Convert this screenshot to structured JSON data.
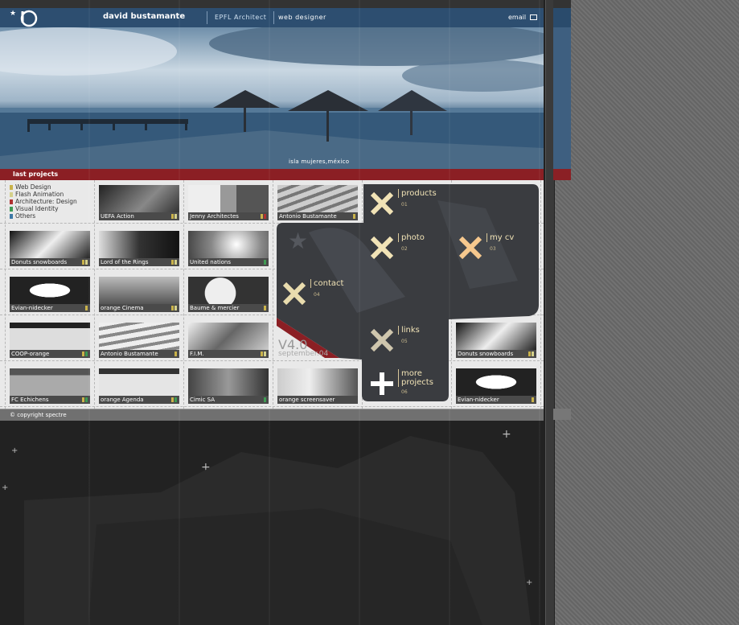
{
  "header": {
    "name": "david bustamante",
    "role1": "EPFL Architect",
    "role2": "web designer",
    "email": "email"
  },
  "hero": {
    "caption": "isla mujeres,méxico"
  },
  "last_projects": {
    "title": "last projects"
  },
  "categories": [
    {
      "label": "Web Design",
      "color": "#c9b24a"
    },
    {
      "label": "Flash Animation",
      "color": "#d4d08a"
    },
    {
      "label": "Architecture: Design",
      "color": "#b03030"
    },
    {
      "label": "Visual Identity",
      "color": "#3f9a54"
    },
    {
      "label": "Others",
      "color": "#3c78a6"
    }
  ],
  "projects": [
    {
      "label": "UEFA Action"
    },
    {
      "label": "Jenny Architectes"
    },
    {
      "label": "Antonio Bustamante"
    },
    {
      "label": "Donuts snowboards"
    },
    {
      "label": "Lord of the Rings"
    },
    {
      "label": "United nations"
    },
    {
      "label": "Evian-nidecker"
    },
    {
      "label": "orange Cinema"
    },
    {
      "label": "Baume & mercier"
    },
    {
      "label": "COOP-orange"
    },
    {
      "label": "Antonio Bustamante"
    },
    {
      "label": "F.I.M."
    },
    {
      "label": "FC Echichens"
    },
    {
      "label": "orange Agenda"
    },
    {
      "label": "Cimic SA"
    },
    {
      "label": "orange screensaver"
    },
    {
      "label": "Donuts snowboards"
    },
    {
      "label": "Evian-nidecker"
    }
  ],
  "nav": [
    {
      "label": "products",
      "num": "01"
    },
    {
      "label": "photo",
      "num": "02"
    },
    {
      "label": "my cv",
      "num": "03"
    },
    {
      "label": "contact",
      "num": "04"
    },
    {
      "label": "links",
      "num": "05"
    },
    {
      "label": "more projects",
      "num": "06"
    }
  ],
  "version": {
    "v": "V4.0",
    "date": "september.04"
  },
  "footer": {
    "copyright": "© copyright spectre"
  }
}
